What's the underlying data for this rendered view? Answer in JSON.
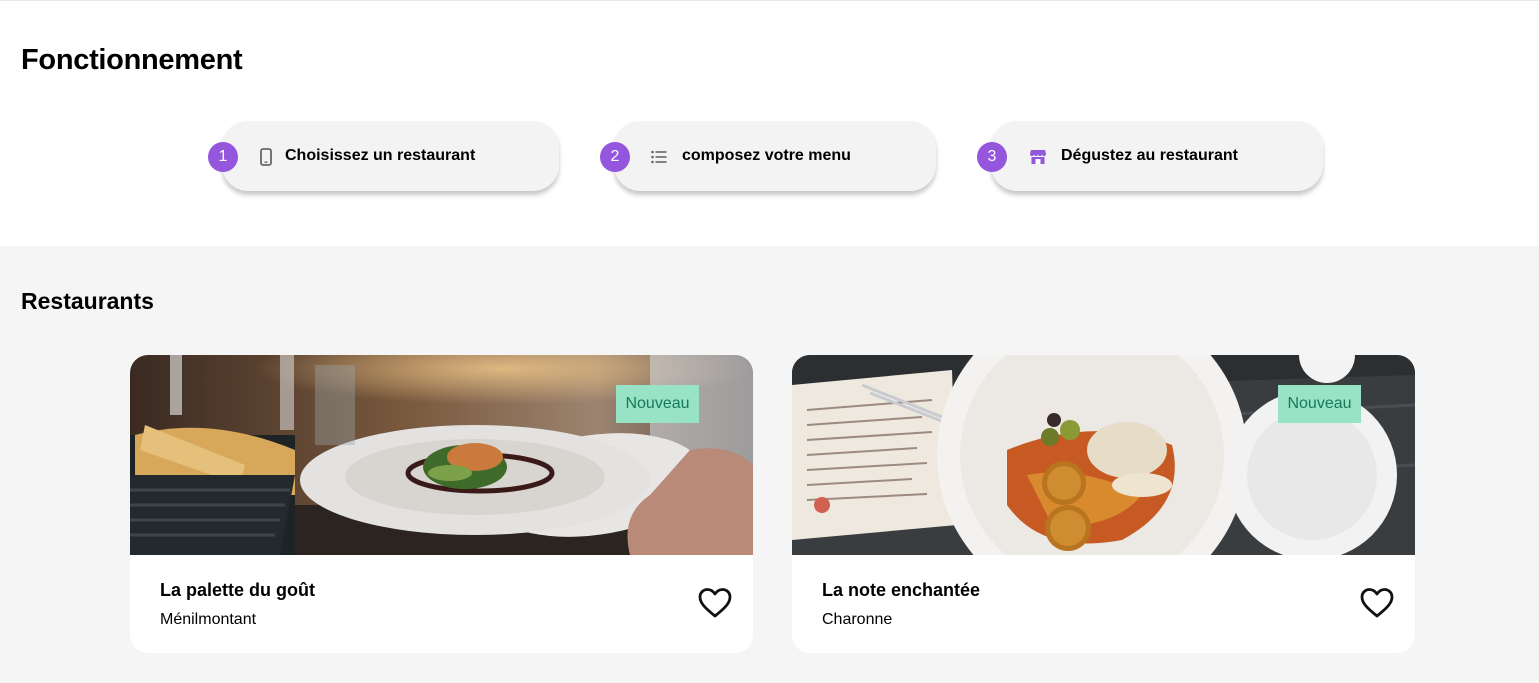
{
  "how_it_works": {
    "title": "Fonctionnement",
    "steps": [
      {
        "number": "1",
        "icon": "smartphone-icon",
        "label": "Choisissez un restaurant"
      },
      {
        "number": "2",
        "icon": "list-icon",
        "label": "composez votre menu"
      },
      {
        "number": "3",
        "icon": "storefront-icon",
        "label": "Dégustez au restaurant"
      }
    ]
  },
  "restaurants": {
    "title": "Restaurants",
    "items": [
      {
        "name": "La palette du goût",
        "area": "Ménilmontant",
        "badge": "Nouveau",
        "favorite_icon": "heart-outline-icon"
      },
      {
        "name": "La note enchantée",
        "area": "Charonne",
        "badge": "Nouveau",
        "favorite_icon": "heart-outline-icon"
      }
    ]
  },
  "colors": {
    "accent": "#9356dc",
    "badge_bg": "#98e2c6",
    "badge_text": "#15795a",
    "section_bg": "#f5f5f5",
    "pill_bg": "#f3f3f3"
  }
}
